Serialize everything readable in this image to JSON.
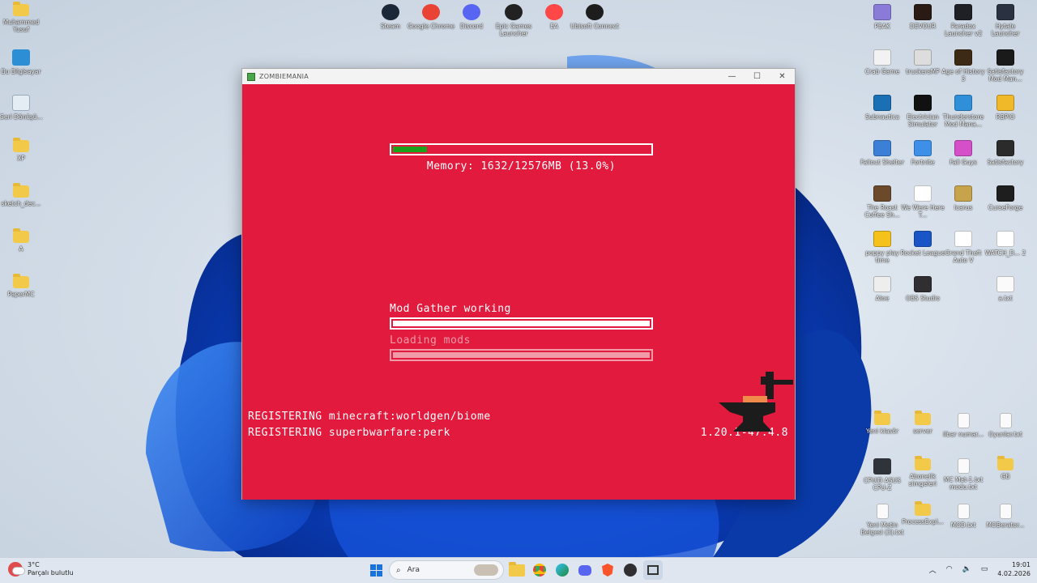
{
  "window": {
    "title": "ZOMBIEMANIA",
    "minimize": "—",
    "maximize": "☐",
    "close": "✕"
  },
  "loader": {
    "memory_text": "Memory: 1632/12576MB (13.0%)",
    "memory_fraction": 0.13,
    "stage1_label": "Mod Gather working",
    "stage1_progress": 1.0,
    "stage2_label": "Loading mods",
    "stage2_progress": 1.0,
    "log_lines": [
      "REGISTERING minecraft:worldgen/biome",
      "REGISTERING superbwarfare:perk"
    ],
    "version": "1.20.1-47.4.8",
    "colors": {
      "background": "#e21a3d",
      "memory_fill": "#1aa31a",
      "faded": "#f19aa8"
    }
  },
  "desktop": {
    "top_icons": [
      {
        "label": "Steam",
        "icon": "steam-icon",
        "color": "#1b2838"
      },
      {
        "label": "Google Chrome",
        "icon": "chrome-icon",
        "color": "#e94335"
      },
      {
        "label": "Discord",
        "icon": "discord-icon",
        "color": "#5865f2"
      },
      {
        "label": "Epic Games Launcher",
        "icon": "epic-icon",
        "color": "#222222"
      },
      {
        "label": "EA",
        "icon": "ea-icon",
        "color": "#ff4747"
      },
      {
        "label": "Ubisoft Connect",
        "icon": "ubisoft-icon",
        "color": "#1d1d1d"
      }
    ],
    "left_icons": [
      {
        "label": "Muhammed Yusuf",
        "kind": "folder"
      },
      {
        "label": "Bu Bilgisayar",
        "kind": "pc"
      },
      {
        "label": "Geri Dönüşü...",
        "kind": "bin"
      },
      {
        "label": "XP",
        "kind": "folder"
      },
      {
        "label": "sketch_dec...",
        "kind": "folder"
      },
      {
        "label": "A",
        "kind": "folder"
      },
      {
        "label": "PaperMC",
        "kind": "folder"
      }
    ],
    "right_icons": [
      {
        "label": "PEAK",
        "color": "#8b7bd8"
      },
      {
        "label": "DEVOUR",
        "color": "#2a1a14"
      },
      {
        "label": "Paradox Launcher v2",
        "color": "#1f2026"
      },
      {
        "label": "Hytale Launcher",
        "color": "#2a3140"
      },
      {
        "label": "Crab Game",
        "color": "#f2f2f2"
      },
      {
        "label": "truckersMP",
        "color": "#dddddd"
      },
      {
        "label": "Age of History 3",
        "color": "#3d2a14"
      },
      {
        "label": "Satisfactory Mod Man...",
        "color": "#1a1a1a"
      },
      {
        "label": "Subnautica",
        "color": "#1a6fb5"
      },
      {
        "label": "Electrician Simulator",
        "color": "#111111"
      },
      {
        "label": "Thunderstore Mod Mana...",
        "color": "#2f8fd9"
      },
      {
        "label": "RBPIO",
        "color": "#f0b929"
      },
      {
        "label": "Fallout Shelter",
        "color": "#3b7fd6"
      },
      {
        "label": "Fortnite",
        "color": "#3d8fe8"
      },
      {
        "label": "Fall Guys",
        "color": "#d44fc8"
      },
      {
        "label": "Satisfactory",
        "color": "#2b2b2b"
      },
      {
        "label": "The Roast Coffee Sh...",
        "color": "#6b4a2c"
      },
      {
        "label": "We Were Here T...",
        "color": "#ffffff"
      },
      {
        "label": "Icarus",
        "color": "#c7a44c"
      },
      {
        "label": "CurseForge",
        "color": "#1e1e1e"
      },
      {
        "label": "poppy play time",
        "color": "#f5c21b"
      },
      {
        "label": "Rocket League",
        "color": "#1a55c7"
      },
      {
        "label": "Grand Theft Auto V",
        "color": "#ffffff"
      },
      {
        "label": "WATCH_D... 2",
        "color": "#ffffff"
      },
      {
        "label": "Aloe",
        "color": "#eeeeee"
      },
      {
        "label": "OBS Studio",
        "color": "#302e31"
      },
      {
        "label": "",
        "color": ""
      },
      {
        "label": "a.txt",
        "color": "#fafafa"
      }
    ],
    "right_lower_icons": [
      {
        "label": "Yeni klasör",
        "kind": "folder"
      },
      {
        "label": "server",
        "kind": "folder"
      },
      {
        "label": "ilbar numar...",
        "kind": "doc"
      },
      {
        "label": "Oyunlar.txt",
        "kind": "doc"
      },
      {
        "label": "CPUID ASUS CPU-Z",
        "kind": "app"
      },
      {
        "label": "Abonelik simgeleri",
        "kind": "folder"
      },
      {
        "label": "MC Mat-1.txt modu.txt",
        "kind": "doc"
      },
      {
        "label": "GB",
        "kind": "folder"
      },
      {
        "label": "Yeni Metin Belgesi (3).txt",
        "kind": "doc"
      },
      {
        "label": "ProcessExpl...",
        "kind": "folder"
      },
      {
        "label": "MOD.txt",
        "kind": "doc"
      },
      {
        "label": "MOBerator...",
        "kind": "doc"
      }
    ]
  },
  "taskbar": {
    "temperature": "3°C",
    "weather": "Parçalı bulutlu",
    "search_placeholder": "Ara",
    "time": "19:01",
    "date": "4.02.2026",
    "notification_badge": "2"
  }
}
